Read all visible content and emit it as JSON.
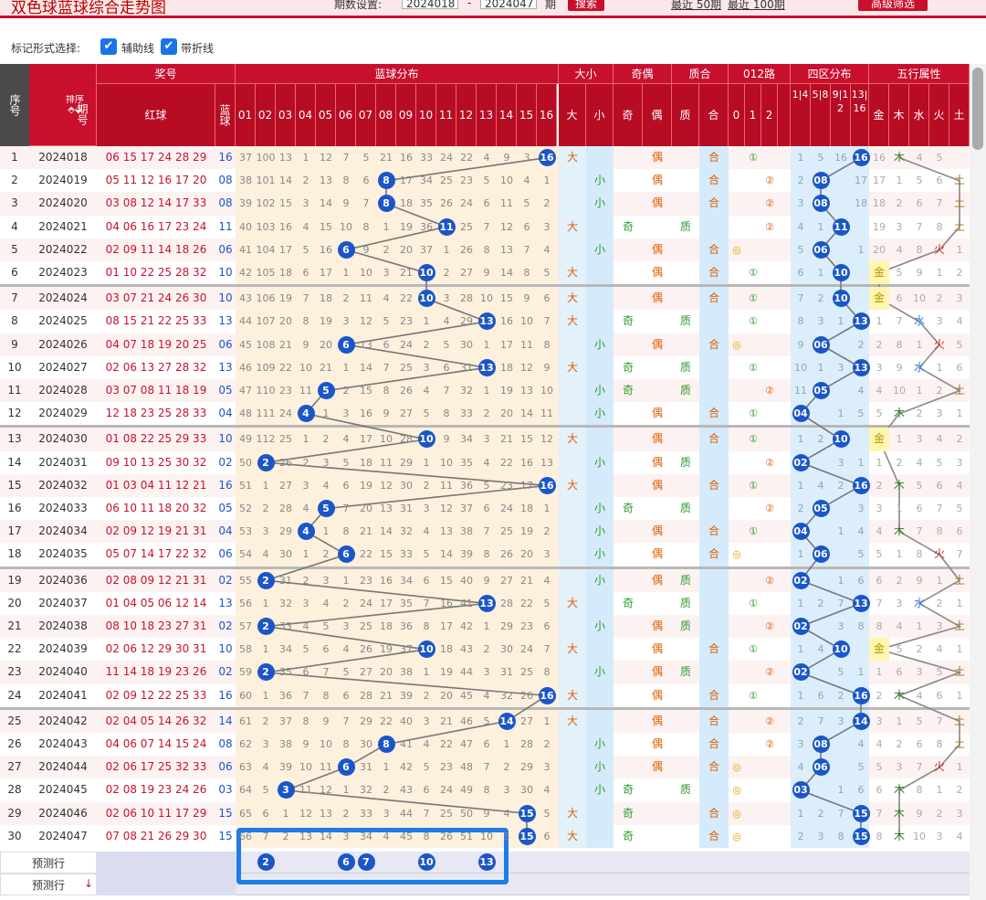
{
  "header": {
    "title": "双色球蓝球综合走势图",
    "range_label": "期数设置:",
    "from_issue": "2024018",
    "dash": "-",
    "to_issue": "2024047",
    "period_unit": "期",
    "search_btn": "搜索",
    "recent50": "最近 50期",
    "recent100": "最近 100期",
    "advanced_btn": "高级筛选"
  },
  "marks": {
    "label": "标记形式选择:",
    "assist": "辅助线",
    "polyline": "带折线",
    "check_glyph": "✔"
  },
  "columns": {
    "seq": "序号",
    "issue": "期号",
    "sort": "排序",
    "award": "奖号",
    "red": "红球",
    "blue": "蓝球",
    "blue_dist": "蓝球分布",
    "size": "大小",
    "big": "大",
    "small": "小",
    "parity": "奇偶",
    "odd": "奇",
    "even": "偶",
    "prime": "质合",
    "zhi": "质",
    "he": "合",
    "road": "012路",
    "zero": "0",
    "one": "1",
    "two": "2",
    "zone": "四区分布",
    "zones": [
      "1|4",
      "5|8",
      "9|12",
      "13|16"
    ],
    "five": "五行属性",
    "elements": [
      "金",
      "木",
      "水",
      "火",
      "土"
    ],
    "nums": [
      "01",
      "02",
      "03",
      "04",
      "05",
      "06",
      "07",
      "08",
      "09",
      "10",
      "11",
      "12",
      "13",
      "14",
      "15",
      "16"
    ]
  },
  "rows": [
    {
      "i": "1",
      "p": "2024018",
      "r": "06 15 17 24 28 29",
      "b": "16",
      "m": [
        37,
        100,
        13,
        1,
        12,
        7,
        5,
        21,
        16,
        33,
        24,
        22,
        4,
        9,
        3
      ],
      "z": [
        1,
        5,
        16
      ],
      "f": [
        16,
        "木",
        4,
        5,
        "",
        0
      ]
    },
    {
      "i": "2",
      "p": "2024019",
      "r": "05 11 12 16 17 20",
      "b": "08",
      "m": [
        38,
        101,
        14,
        2,
        13,
        8,
        6,
        "",
        17,
        34,
        25,
        23,
        5,
        10,
        4,
        1
      ],
      "z": [
        2,
        "",
        17,
        1
      ],
      "f": [
        17,
        1,
        5,
        6,
        "土"
      ]
    },
    {
      "i": "3",
      "p": "2024020",
      "r": "03 08 12 14 17 33",
      "b": "08",
      "m": [
        39,
        102,
        15,
        3,
        14,
        9,
        7,
        "",
        18,
        35,
        26,
        24,
        6,
        11,
        5,
        2
      ],
      "z": [
        3,
        "",
        18,
        2
      ],
      "f": [
        18,
        2,
        6,
        7,
        "土"
      ]
    },
    {
      "i": "4",
      "p": "2024021",
      "r": "04 06 16 17 23 24",
      "b": "11",
      "m": [
        40,
        103,
        16,
        4,
        15,
        10,
        8,
        1,
        19,
        36,
        "",
        25,
        7,
        12,
        6,
        3
      ],
      "z": [
        4,
        1,
        "",
        3
      ],
      "f": [
        19,
        3,
        7,
        8,
        "土"
      ]
    },
    {
      "i": "5",
      "p": "2024022",
      "r": "02 09 11 14 18 26",
      "b": "06",
      "m": [
        41,
        104,
        17,
        5,
        16,
        "",
        9,
        2,
        20,
        37,
        1,
        26,
        8,
        13,
        7,
        4
      ],
      "z": [
        5,
        "",
        1,
        4
      ],
      "f": [
        20,
        4,
        8,
        "火",
        1
      ]
    },
    {
      "i": "6",
      "p": "2024023",
      "r": "01 10 22 25 28 32",
      "b": "10",
      "m": [
        42,
        105,
        18,
        6,
        17,
        1,
        10,
        3,
        21,
        "",
        2,
        27,
        9,
        14,
        8,
        5
      ],
      "z": [
        6,
        1,
        "",
        5
      ],
      "f": [
        "金",
        5,
        9,
        1,
        2
      ]
    },
    {
      "i": "7",
      "p": "2024024",
      "r": "03 07 21 24 26 30",
      "b": "10",
      "m": [
        43,
        106,
        19,
        7,
        18,
        2,
        11,
        4,
        22,
        "",
        3,
        28,
        10,
        15,
        9,
        6
      ],
      "z": [
        7,
        2,
        "",
        6
      ],
      "f": [
        "金",
        6,
        10,
        2,
        3
      ]
    },
    {
      "i": "8",
      "p": "2024025",
      "r": "08 15 21 22 25 33",
      "b": "13",
      "m": [
        44,
        107,
        20,
        8,
        19,
        3,
        12,
        5,
        23,
        1,
        4,
        29,
        "",
        16,
        10,
        7
      ],
      "z": [
        8,
        3,
        1,
        ""
      ],
      "f": [
        1,
        7,
        "水",
        3,
        4
      ]
    },
    {
      "i": "9",
      "p": "2024026",
      "r": "04 07 18 19 20 25",
      "b": "06",
      "m": [
        45,
        108,
        21,
        9,
        20,
        "",
        13,
        6,
        24,
        2,
        5,
        30,
        1,
        17,
        11,
        8
      ],
      "z": [
        9,
        "",
        2,
        1
      ],
      "f": [
        2,
        8,
        1,
        "火",
        5
      ]
    },
    {
      "i": "10",
      "p": "2024027",
      "r": "02 06 13 27 28 32",
      "b": "13",
      "m": [
        46,
        109,
        22,
        10,
        21,
        1,
        14,
        7,
        25,
        3,
        6,
        31,
        "",
        18,
        12,
        9
      ],
      "z": [
        10,
        1,
        3,
        ""
      ],
      "f": [
        3,
        9,
        "水",
        1,
        6
      ]
    },
    {
      "i": "11",
      "p": "2024028",
      "r": "03 07 08 11 18 19",
      "b": "05",
      "m": [
        47,
        110,
        23,
        11,
        "",
        2,
        15,
        8,
        26,
        4,
        7,
        32,
        1,
        19,
        13,
        10
      ],
      "z": [
        11,
        "",
        4,
        1
      ],
      "f": [
        4,
        10,
        1,
        2,
        "土"
      ]
    },
    {
      "i": "12",
      "p": "2024029",
      "r": "12 18 23 25 28 33",
      "b": "04",
      "m": [
        48,
        111,
        24,
        "",
        1,
        3,
        16,
        9,
        27,
        5,
        8,
        33,
        2,
        20,
        14,
        11
      ],
      "z": [
        "",
        1,
        5,
        2
      ],
      "f": [
        5,
        "木",
        2,
        3,
        1
      ]
    },
    {
      "i": "13",
      "p": "2024030",
      "r": "01 08 22 25 29 33",
      "b": "10",
      "m": [
        49,
        112,
        25,
        1,
        2,
        4,
        17,
        10,
        28,
        "",
        9,
        34,
        3,
        21,
        15,
        12
      ],
      "z": [
        1,
        2,
        "",
        3
      ],
      "f": [
        "金",
        1,
        3,
        4,
        2
      ]
    },
    {
      "i": "14",
      "p": "2024031",
      "r": "09 10 13 25 30 32",
      "b": "02",
      "m": [
        50,
        "",
        26,
        2,
        3,
        5,
        18,
        11,
        29,
        1,
        10,
        35,
        4,
        22,
        16,
        13
      ],
      "z": [
        "",
        3,
        1,
        4
      ],
      "f": [
        1,
        2,
        4,
        5,
        3
      ]
    },
    {
      "i": "15",
      "p": "2024032",
      "r": "01 03 04 11 12 21",
      "b": "16",
      "m": [
        51,
        1,
        27,
        3,
        4,
        6,
        19,
        12,
        30,
        2,
        11,
        36,
        5,
        23,
        17,
        ""
      ],
      "z": [
        1,
        4,
        2,
        ""
      ],
      "f": [
        2,
        "木",
        5,
        6,
        4
      ]
    },
    {
      "i": "16",
      "p": "2024033",
      "r": "06 10 11 18 20 32",
      "b": "05",
      "m": [
        52,
        2,
        28,
        4,
        "",
        7,
        20,
        13,
        31,
        3,
        12,
        37,
        6,
        24,
        18,
        1
      ],
      "z": [
        2,
        "",
        3,
        1
      ],
      "f": [
        3,
        1,
        6,
        7,
        5
      ]
    },
    {
      "i": "17",
      "p": "2024034",
      "r": "02 09 12 19 21 31",
      "b": "04",
      "m": [
        53,
        3,
        29,
        "",
        1,
        8,
        21,
        14,
        32,
        4,
        13,
        38,
        7,
        25,
        19,
        2
      ],
      "z": [
        "",
        1,
        4,
        2
      ],
      "f": [
        4,
        "木",
        7,
        8,
        6
      ]
    },
    {
      "i": "18",
      "p": "2024035",
      "r": "05 07 14 17 22 32",
      "b": "06",
      "m": [
        54,
        4,
        30,
        1,
        2,
        "",
        22,
        15,
        33,
        5,
        14,
        39,
        8,
        26,
        20,
        3
      ],
      "z": [
        1,
        "",
        5,
        3
      ],
      "f": [
        5,
        1,
        8,
        "火",
        7
      ]
    },
    {
      "i": "19",
      "p": "2024036",
      "r": "02 08 09 12 21 31",
      "b": "02",
      "m": [
        55,
        "",
        31,
        2,
        3,
        1,
        23,
        16,
        34,
        6,
        15,
        40,
        9,
        27,
        21,
        4
      ],
      "z": [
        "",
        1,
        6,
        4
      ],
      "f": [
        6,
        2,
        9,
        1,
        "土"
      ]
    },
    {
      "i": "20",
      "p": "2024037",
      "r": "01 04 05 06 12 14",
      "b": "13",
      "m": [
        56,
        1,
        32,
        3,
        4,
        2,
        24,
        17,
        35,
        7,
        16,
        41,
        "",
        28,
        22,
        5
      ],
      "z": [
        1,
        2,
        7,
        ""
      ],
      "f": [
        7,
        3,
        "水",
        2,
        1
      ]
    },
    {
      "i": "21",
      "p": "2024038",
      "r": "08 10 18 23 27 31",
      "b": "02",
      "m": [
        57,
        "",
        33,
        4,
        5,
        3,
        25,
        18,
        36,
        8,
        17,
        42,
        1,
        29,
        23,
        6
      ],
      "z": [
        "",
        3,
        8,
        1
      ],
      "f": [
        8,
        4,
        1,
        3,
        "土"
      ]
    },
    {
      "i": "22",
      "p": "2024039",
      "r": "02 06 12 29 30 31",
      "b": "10",
      "m": [
        58,
        1,
        34,
        5,
        6,
        4,
        26,
        19,
        37,
        "",
        18,
        43,
        2,
        30,
        24,
        7
      ],
      "z": [
        1,
        4,
        "",
        2
      ],
      "f": [
        "金",
        5,
        2,
        4,
        1
      ]
    },
    {
      "i": "23",
      "p": "2024040",
      "r": "11 14 18 19 23 26",
      "b": "02",
      "m": [
        59,
        "",
        35,
        6,
        7,
        5,
        27,
        20,
        38,
        1,
        19,
        44,
        3,
        31,
        25,
        8
      ],
      "z": [
        "",
        5,
        1,
        3
      ],
      "f": [
        1,
        6,
        3,
        5,
        "土"
      ]
    },
    {
      "i": "24",
      "p": "2024041",
      "r": "02 09 12 22 25 33",
      "b": "16",
      "m": [
        60,
        1,
        36,
        7,
        8,
        6,
        28,
        21,
        39,
        2,
        20,
        45,
        4,
        32,
        26,
        ""
      ],
      "z": [
        1,
        6,
        2,
        ""
      ],
      "f": [
        2,
        "木",
        4,
        6,
        1
      ]
    },
    {
      "i": "25",
      "p": "2024042",
      "r": "02 04 05 14 26 32",
      "b": "14",
      "m": [
        61,
        2,
        37,
        8,
        9,
        7,
        29,
        22,
        40,
        3,
        21,
        46,
        5,
        "",
        27,
        1
      ],
      "z": [
        2,
        7,
        3,
        ""
      ],
      "f": [
        3,
        1,
        5,
        7,
        "土"
      ]
    },
    {
      "i": "26",
      "p": "2024043",
      "r": "04 06 07 14 15 24",
      "b": "08",
      "m": [
        62,
        3,
        38,
        9,
        10,
        8,
        30,
        "",
        41,
        4,
        22,
        47,
        6,
        1,
        28,
        2
      ],
      "z": [
        3,
        "",
        4,
        1
      ],
      "f": [
        4,
        2,
        6,
        8,
        "土"
      ]
    },
    {
      "i": "27",
      "p": "2024044",
      "r": "02 06 17 25 32 33",
      "b": "06",
      "m": [
        63,
        4,
        39,
        10,
        11,
        "",
        31,
        1,
        42,
        5,
        23,
        48,
        7,
        2,
        29,
        3
      ],
      "z": [
        4,
        "",
        5,
        2
      ],
      "f": [
        5,
        3,
        7,
        "火",
        1
      ]
    },
    {
      "i": "28",
      "p": "2024045",
      "r": "02 08 19 23 24 26",
      "b": "03",
      "m": [
        64,
        5,
        "",
        11,
        12,
        1,
        32,
        2,
        43,
        6,
        24,
        49,
        8,
        3,
        30,
        4
      ],
      "z": [
        "",
        1,
        6,
        3
      ],
      "f": [
        6,
        "木",
        8,
        1,
        2
      ]
    },
    {
      "i": "29",
      "p": "2024046",
      "r": "02 06 10 11 17 29",
      "b": "15",
      "m": [
        65,
        6,
        1,
        12,
        13,
        2,
        33,
        3,
        44,
        7,
        25,
        50,
        9,
        4,
        "",
        5
      ],
      "z": [
        1,
        2,
        7,
        ""
      ],
      "f": [
        7,
        "木",
        9,
        2,
        3
      ]
    },
    {
      "i": "30",
      "p": "2024047",
      "r": "07 08 21 26 29 30",
      "b": "15",
      "m": [
        66,
        7,
        2,
        13,
        14,
        3,
        34,
        4,
        45,
        8,
        26,
        51,
        10,
        5,
        "",
        6
      ],
      "z": [
        2,
        3,
        8,
        ""
      ],
      "f": [
        8,
        "木",
        10,
        3,
        4
      ]
    }
  ],
  "predict": {
    "label": "预测行",
    "balls": [
      "2",
      "6",
      "7",
      "10",
      "13"
    ],
    "arrow": "↓"
  }
}
